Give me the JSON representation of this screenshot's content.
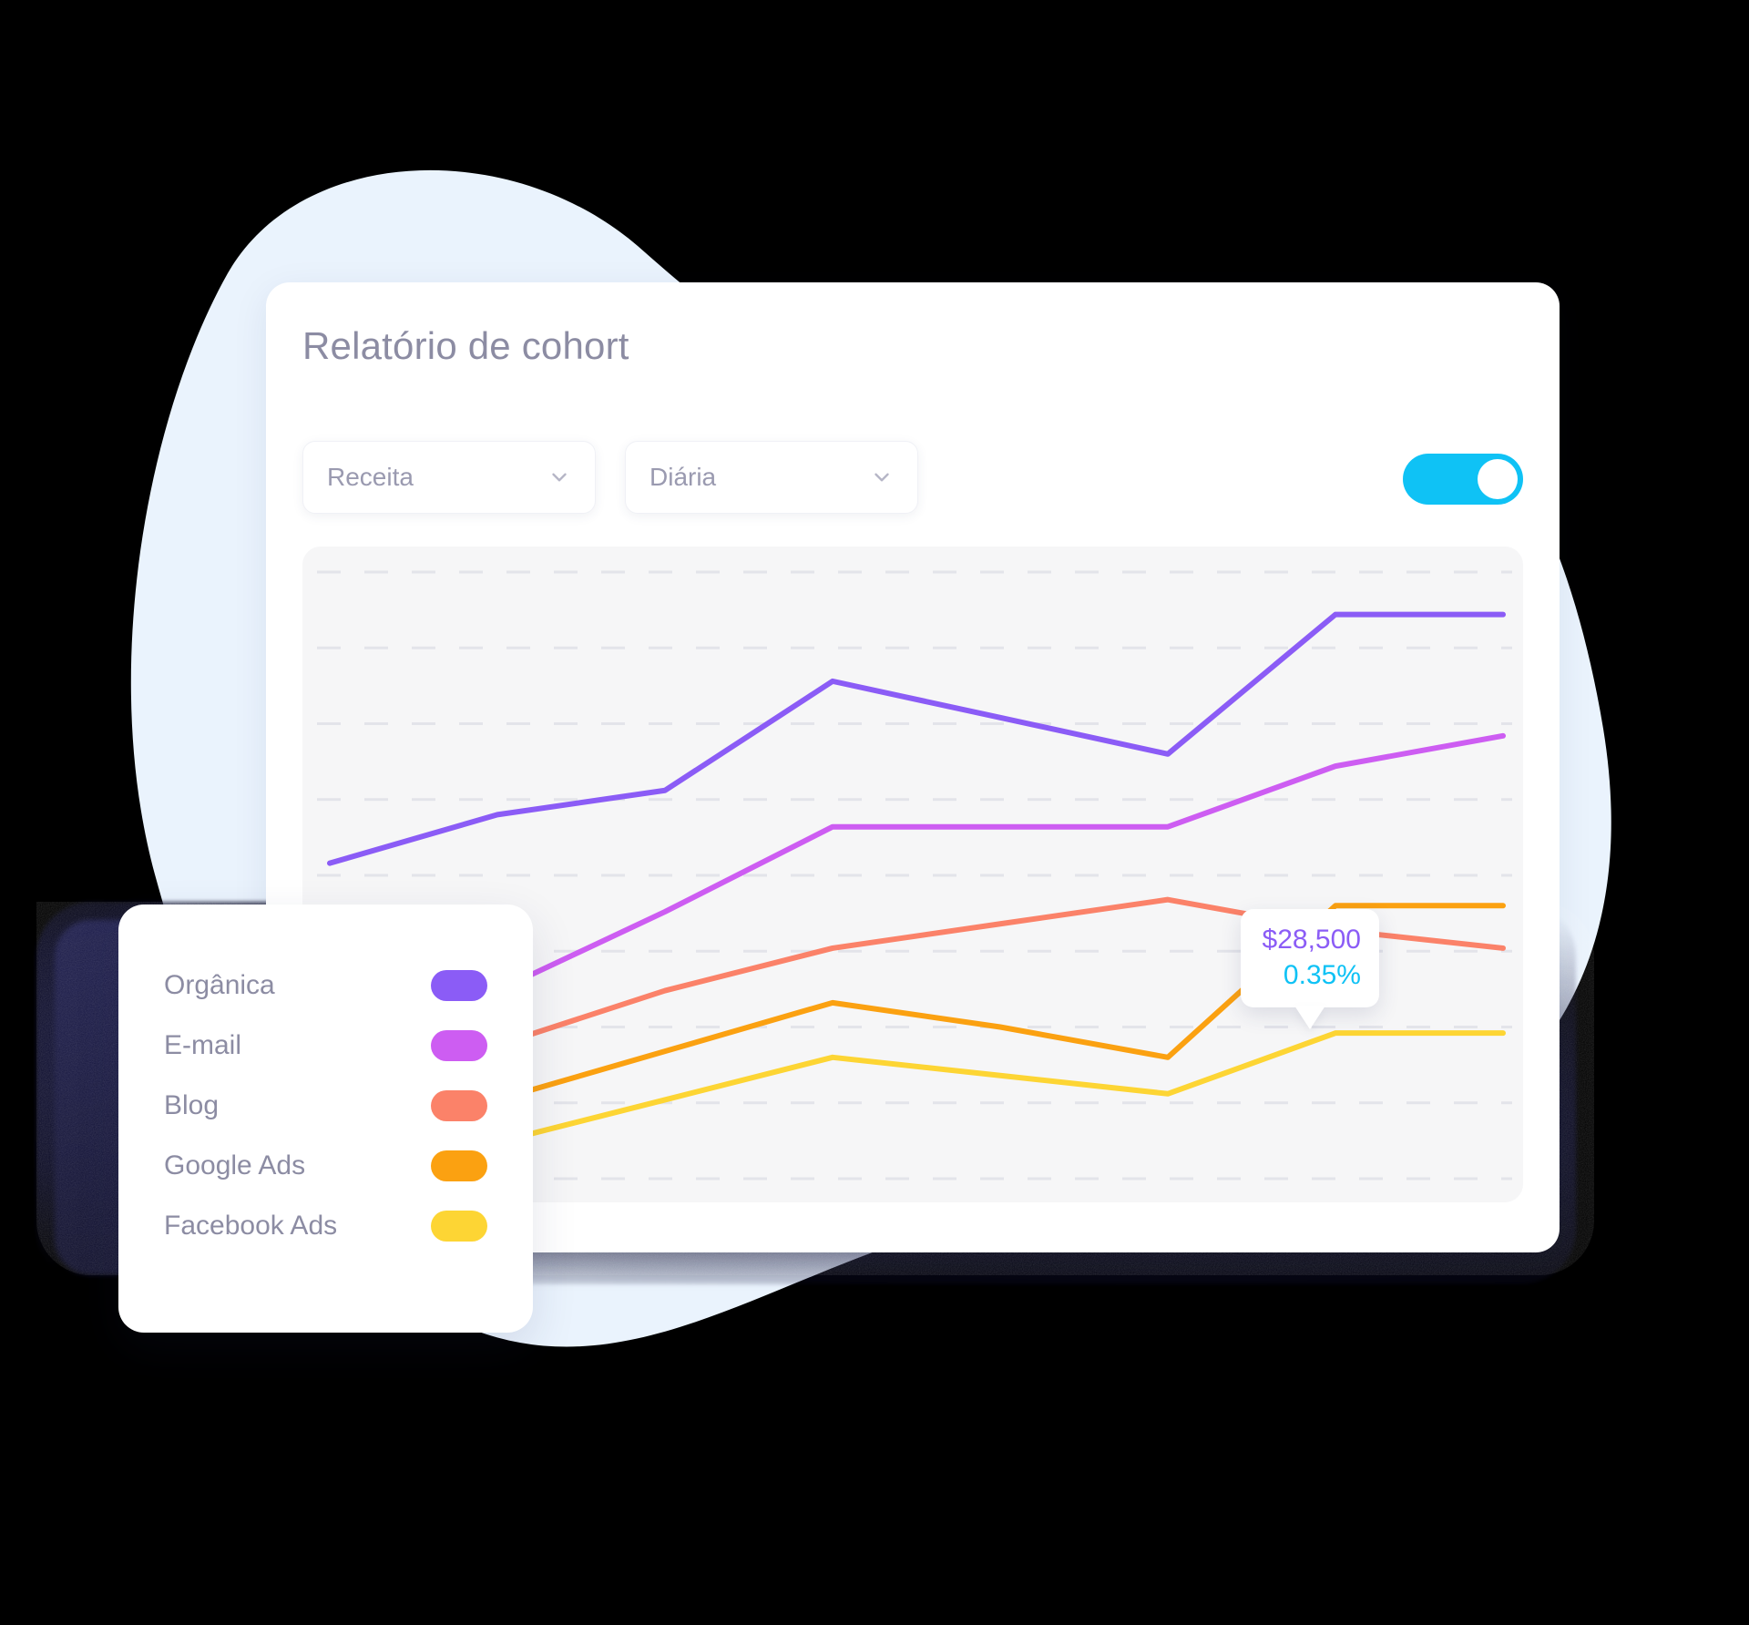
{
  "card": {
    "title": "Relatório de cohort"
  },
  "controls": {
    "metric_select": {
      "value": "Receita",
      "icon": "chevron-down-icon"
    },
    "period_select": {
      "value": "Diária",
      "icon": "chevron-down-icon"
    },
    "toggle": {
      "state": "on",
      "color": "#0fc2f5"
    }
  },
  "tooltip": {
    "value": "$28,500",
    "percent": "0.35%",
    "value_color": "#8b5cf6",
    "percent_color": "#0fc2f5"
  },
  "legend": {
    "items": [
      {
        "label": "Orgânica",
        "color": "#8b5cf6"
      },
      {
        "label": "E-mail",
        "color": "#cd5df2"
      },
      {
        "label": "Blog",
        "color": "#fb8269"
      },
      {
        "label": "Google Ads",
        "color": "#fba111"
      },
      {
        "label": "Facebook Ads",
        "color": "#fdd534"
      }
    ]
  },
  "chart_data": {
    "type": "line",
    "title": "Relatório de cohort",
    "xlabel": "",
    "ylabel": "",
    "grid": "horizontal-dashed",
    "legend_position": "external-left-card",
    "x": [
      0,
      1,
      2,
      3,
      4,
      5,
      6,
      7
    ],
    "xlim": [
      0,
      7
    ],
    "ylim": [
      0,
      100
    ],
    "series": [
      {
        "name": "Orgânica",
        "color": "#8b5cf6",
        "values": [
          52,
          60,
          64,
          82,
          76,
          70,
          93,
          93
        ]
      },
      {
        "name": "E-mail",
        "color": "#cd5df2",
        "values": [
          31,
          31,
          44,
          58,
          58,
          58,
          68,
          73
        ]
      },
      {
        "name": "Blog",
        "color": "#fb8269",
        "values": [
          22,
          22,
          31,
          38,
          42,
          46,
          41,
          38
        ]
      },
      {
        "name": "Google Ads",
        "color": "#fba111",
        "values": [
          13,
          13,
          21,
          29,
          25,
          20,
          45,
          45
        ]
      },
      {
        "name": "Facebook Ads",
        "color": "#fdd534",
        "values": [
          6,
          6,
          13,
          20,
          17,
          14,
          24,
          24
        ]
      }
    ],
    "annotations": [
      {
        "series": "Orgânica",
        "x": 4,
        "label_value": "$28,500",
        "label_percent": "0.35%"
      }
    ]
  },
  "colors": {
    "background_blob": "#eaf3fd",
    "card_background": "#ffffff",
    "plot_background": "#f6f6f7",
    "gridline": "#e3e4ea",
    "text_muted": "#8c8ca3",
    "accent": "#0fc2f5",
    "shadow_dark": "#15154a"
  }
}
